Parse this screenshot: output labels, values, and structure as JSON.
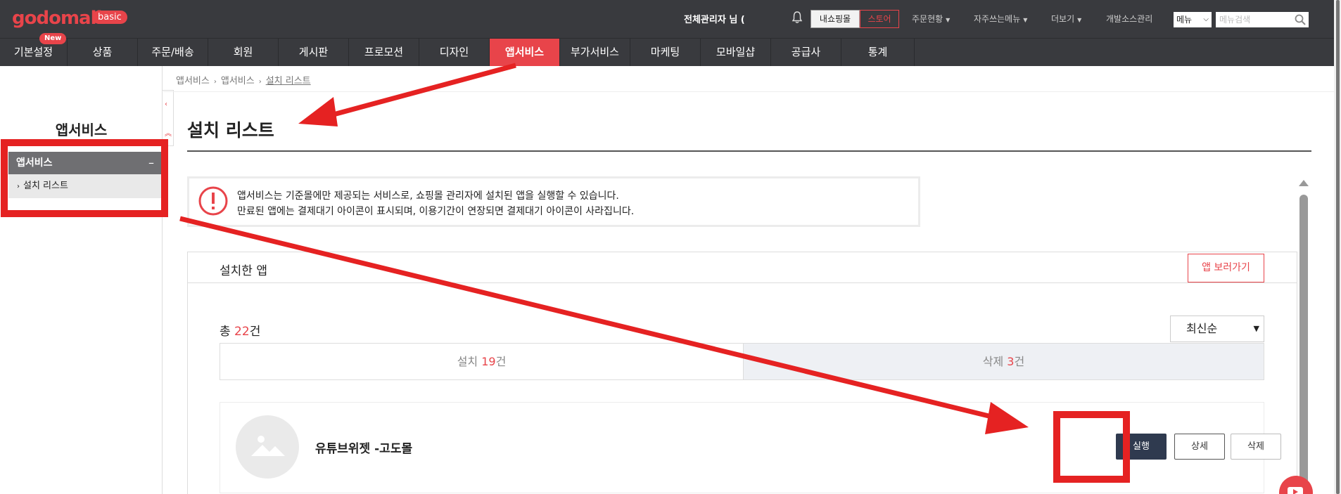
{
  "header": {
    "logo": "godomall",
    "logo_badge": "basic",
    "admin_name": "전체관리자 님 (",
    "my_shop": "내쇼핑몰",
    "store": "스토어",
    "links": [
      "주문현황",
      "자주쓰는메뉴",
      "더보기",
      "개발소스관리"
    ],
    "menu_select": "메뉴",
    "menu_search_placeholder": "메뉴검색"
  },
  "nav": {
    "new_badge": "New",
    "items": [
      "기본설정",
      "상품",
      "주문/배송",
      "회원",
      "게시판",
      "프로모션",
      "디자인",
      "앱서비스",
      "부가서비스",
      "마케팅",
      "모바일샵",
      "공급사",
      "통계"
    ],
    "active": "앱서비스"
  },
  "sidebar": {
    "title": "앱서비스",
    "group": "앱서비스",
    "group_toggle": "–",
    "item": "설치 리스트"
  },
  "breadcrumb": [
    "앱서비스",
    "앱서비스",
    "설치 리스트"
  ],
  "page": {
    "title": "설치 리스트",
    "notice": [
      "앱서비스는 기준몰에만 제공되는 서비스로, 쇼핑몰 관리자에 설치된 앱을 실행할 수 있습니다.",
      "만료된 앱에는 결제대기 아이콘이 표시되며, 이용기간이 연장되면 결제대기 아이콘이 사라집니다."
    ]
  },
  "panel": {
    "title": "설치한 앱",
    "view_apps_button": "앱 보러가기",
    "total_prefix": "총 ",
    "total_count": "22",
    "total_suffix": "건",
    "sort": "최신순",
    "tabs": [
      {
        "label": "설치 ",
        "count": "19",
        "suffix": "건"
      },
      {
        "label": "삭제 ",
        "count": "3",
        "suffix": "건"
      }
    ],
    "app": {
      "name": "유튜브위젯 -고도몰",
      "run": "실행",
      "detail": "상세",
      "delete": "삭제"
    }
  },
  "colors": {
    "accent": "#e8444a",
    "header_bg": "#393a3e",
    "annotation": "#e52222"
  }
}
